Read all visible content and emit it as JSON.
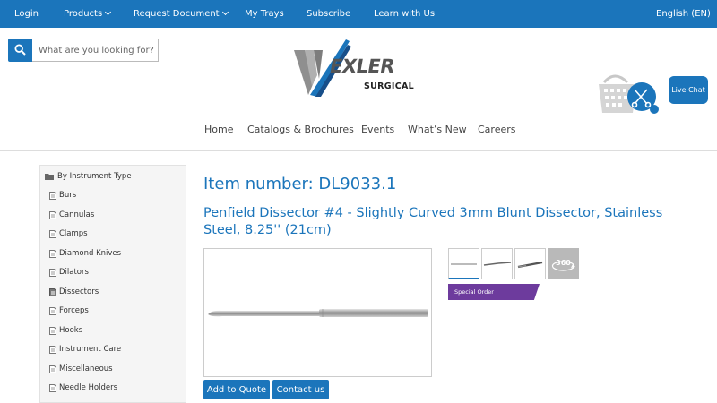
{
  "topbar": {
    "login": "Login",
    "products": "Products",
    "request_document": "Request Document",
    "my_trays": "My Trays",
    "subscribe": "Subscribe",
    "learn_with_us": "Learn with Us",
    "language": "English (EN)"
  },
  "search": {
    "placeholder": "What are you looking for?"
  },
  "logo": {
    "wordmark": "EXLER",
    "subtitle": "SURGICAL"
  },
  "live_chat": "Live Chat",
  "main_nav": [
    "Home",
    "Catalogs & Brochures",
    "Events",
    "What’s New",
    "Careers"
  ],
  "sidebar": {
    "header": "By Instrument Type",
    "items": [
      "Burs",
      "Cannulas",
      "Clamps",
      "Diamond Knives",
      "Dilators",
      "Dissectors",
      "Forceps",
      "Hooks",
      "Instrument Care",
      "Miscellaneous",
      "Needle Holders"
    ]
  },
  "item": {
    "number": "Item number: DL9033.1",
    "title": "Penfield Dissector #4 - Slightly Curved 3mm Blunt Dissector, Stainless Steel, 8.25'' (21cm)",
    "badge": "Special Order",
    "thumb_360_label": "360"
  },
  "buttons": {
    "add_to_quote": "Add to Quote",
    "contact_us": "Contact us"
  },
  "colors": {
    "brand_blue": "#1b75bb",
    "special_order_purple": "#6d3b9d"
  }
}
